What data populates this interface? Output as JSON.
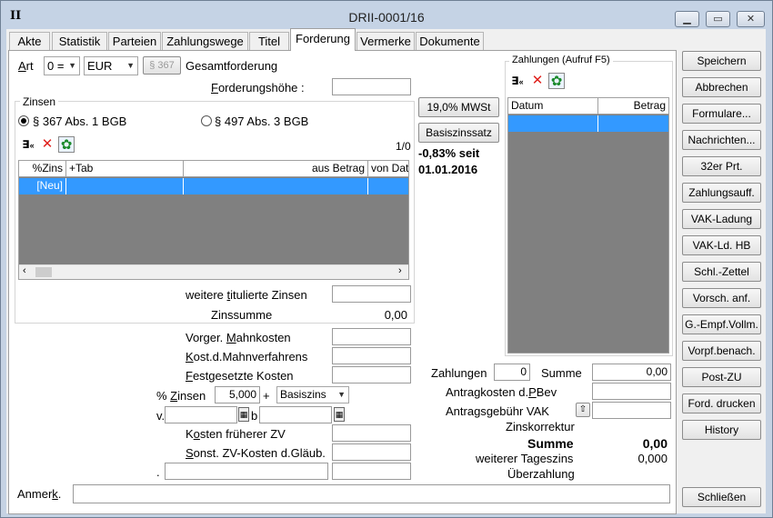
{
  "window": {
    "title": "DRII-0001/16",
    "app_icon": "II"
  },
  "tabs": [
    "Akte",
    "Statistik",
    "Parteien",
    "Zahlungswege",
    "Titel",
    "Forderung",
    "Vermerke",
    "Dokumente"
  ],
  "art": {
    "label": "Art",
    "art_value": "0 =",
    "currency": "EUR",
    "section_btn": "§ 367",
    "desc": "Gesamtforderung"
  },
  "forderungshoehe": {
    "label": "Forderungshöhe :",
    "value": ""
  },
  "zinsen": {
    "group_label": "Zinsen",
    "radio1": "§ 367 Abs. 1 BGB",
    "radio2": "§ 497 Abs. 3 BGB",
    "count": "1/0",
    "columns": [
      "%Zins",
      "+Tab",
      "aus Betrag",
      "von Dat"
    ],
    "row_new": "[Neu]",
    "weitere_label": "weitere titulierte Zinsen",
    "weitere_value": "",
    "summe_label": "Zinssumme",
    "summe_value": "0,00"
  },
  "mwst_btn": "19,0% MWSt",
  "basis_btn": "Basiszinssatz",
  "basis_text1": "-0,83% seit",
  "basis_text2": "01.01.2016",
  "kosten": {
    "vorger": "Vorger. Mahnkosten",
    "kost": "Kost.d.Mahnverfahrens",
    "fest": "Festgesetzte Kosten",
    "pzinsen": "% Zinsen",
    "pzinsen_value": "5,000",
    "plus": "+",
    "basiszins": "Basiszins",
    "v": "v.",
    "b": "b",
    "frueher": "Kosten früherer ZV",
    "sonst": "Sonst. ZV-Kosten d.Gläub.",
    "underscore": "."
  },
  "zahlungen": {
    "group_label": "Zahlungen (Aufruf F5)",
    "columns": [
      "Datum",
      "Betrag"
    ],
    "zahlungen_label": "Zahlungen",
    "zahlungen_value": "0",
    "summe_label": "Summe",
    "summe_value": "0,00",
    "antrag_pbev": "Antragkosten d.PBev",
    "antrag_vak": "Antragsgebühr VAK",
    "zinskorrektur": "Zinskorrektur",
    "summe2_label": "Summe",
    "summe2_value": "0,00",
    "tageszins_label": "weiterer Tageszins",
    "tageszins_value": "0,000",
    "ueberzahlung": "Überzahlung"
  },
  "anmerk_label": "Anmerk.",
  "right_buttons": [
    "Speichern",
    "Abbrechen",
    "Formulare...",
    "Nachrichten...",
    "32er Prt.",
    "Zahlungsauff.",
    "VAK-Ladung",
    "VAK-Ld. HB",
    "Schl.-Zettel",
    "Vorsch. anf.",
    "G.-Empf.Vollm.",
    "Vorpf.benach.",
    "Post-ZU",
    "Ford. drucken",
    "History"
  ],
  "close_btn": "Schließen"
}
